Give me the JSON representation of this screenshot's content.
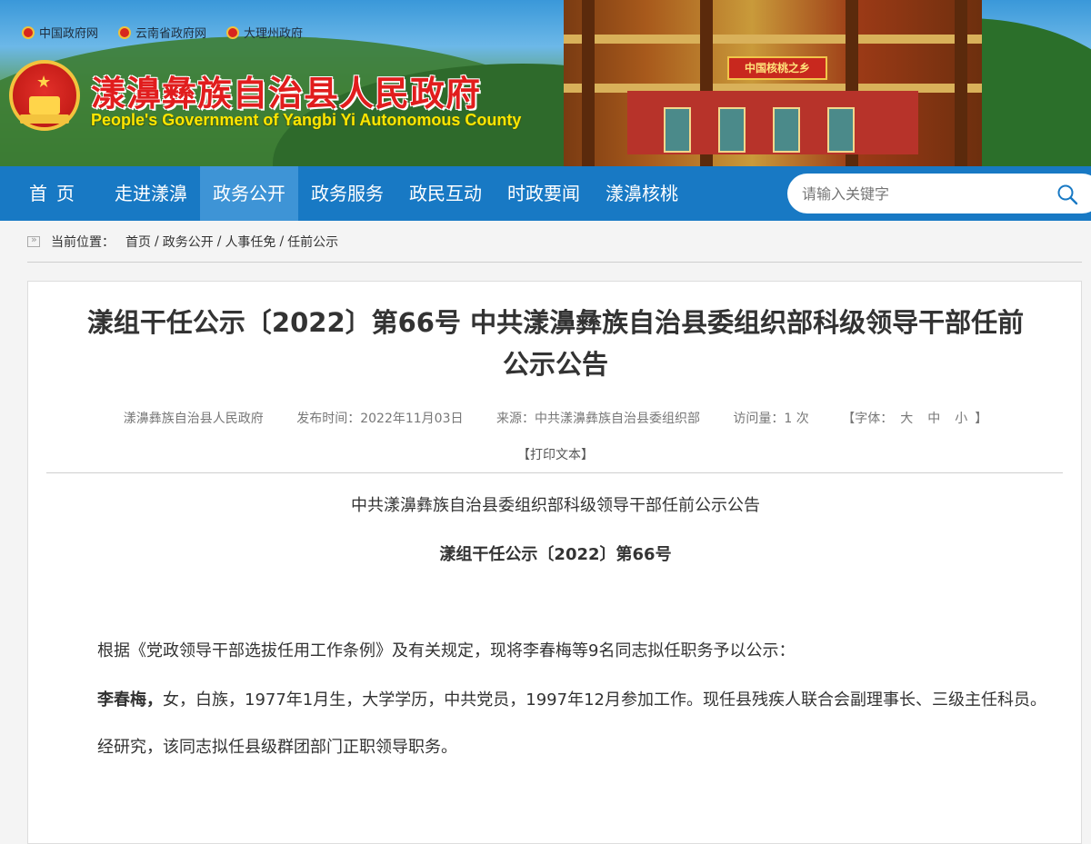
{
  "header": {
    "top_links": [
      {
        "label": "中国政府网"
      },
      {
        "label": "云南省政府网"
      },
      {
        "label": "大理州政府"
      }
    ],
    "site_title": "漾濞彝族自治县人民政府",
    "site_subtitle": "People's Government of Yangbi Yi Autonomous County",
    "gate_sign": "中国核桃之乡"
  },
  "nav": {
    "items": [
      {
        "label": "首页"
      },
      {
        "label": "走进漾濞"
      },
      {
        "label": "政务公开"
      },
      {
        "label": "政务服务"
      },
      {
        "label": "政民互动"
      },
      {
        "label": "时政要闻"
      },
      {
        "label": "漾濞核桃"
      }
    ],
    "active_index": 2,
    "search_placeholder": "请输入关键字"
  },
  "breadcrumb": {
    "label": "当前位置：",
    "items": [
      "首页",
      "政务公开",
      "人事任免",
      "任前公示"
    ],
    "separator": "/"
  },
  "article": {
    "title": "漾组干任公示〔2022〕第66号 中共漾濞彝族自治县委组织部科级领导干部任前公示公告",
    "meta": {
      "publisher": "漾濞彝族自治县人民政府",
      "publish_time": "发布时间：2022年11月03日",
      "source": "来源：中共漾濞彝族自治县委组织部",
      "visits": "访问量：1 次",
      "font_label": "【字体：",
      "font_large": "大",
      "font_medium": "中",
      "font_small": "小",
      "font_close": "】"
    },
    "print_label": "【打印文本】",
    "doc_heading": "中共漾濞彝族自治县委组织部科级领导干部任前公示公告",
    "doc_number": "漾组干任公示〔2022〕第66号",
    "para1": "根据《党政领导干部选拔任用工作条例》及有关规定，现将李春梅等9名同志拟任职务予以公示：",
    "para2_name": "李春梅，",
    "para2_text": "女，白族，1977年1月生，大学学历，中共党员，1997年12月参加工作。现任县残疾人联合会副理事长、三级主任科员。",
    "para3": "经研究，该同志拟任县级群团部门正职领导职务。"
  },
  "colors": {
    "nav_bg": "#1879c4",
    "nav_active": "#3e94d6",
    "title_red": "#e11d1d",
    "subtitle_yellow": "#ffe600"
  }
}
